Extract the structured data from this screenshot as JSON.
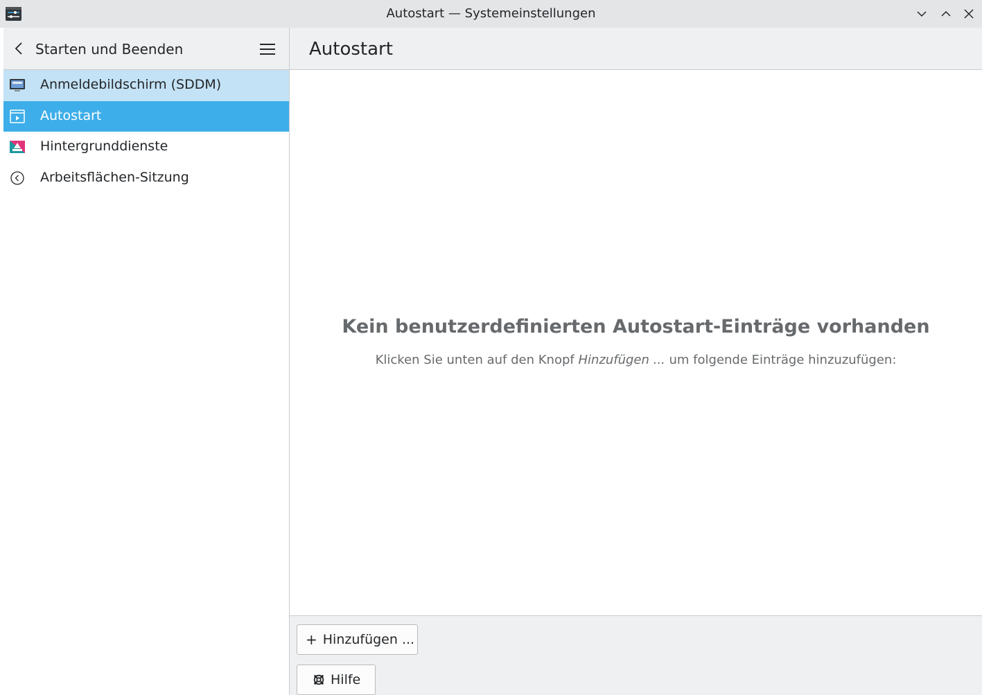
{
  "window": {
    "title": "Autostart — Systemeinstellungen",
    "icons": [
      "settings-app-icon",
      "minimize-icon",
      "maximize-icon",
      "close-icon"
    ]
  },
  "sidebar": {
    "title": "Starten und Beenden",
    "items": [
      {
        "label": "Anmeldebildschirm (SDDM)",
        "icon": "monitor-icon",
        "state": "hover"
      },
      {
        "label": "Autostart",
        "icon": "autostart-icon",
        "state": "selected"
      },
      {
        "label": "Hintergrunddienste",
        "icon": "services-icon",
        "state": "normal"
      },
      {
        "label": "Arbeitsflächen-Sitzung",
        "icon": "session-icon",
        "state": "normal"
      }
    ]
  },
  "main": {
    "title": "Autostart",
    "empty_title": "Kein benutzerdefinierten Autostart-Einträge vorhanden",
    "empty_sub_before": "Klicken Sie unten auf den Knopf ",
    "empty_sub_em": "Hinzufügen ...",
    "empty_sub_after": " um folgende Einträge hinzuzufügen:"
  },
  "footer": {
    "add_label": "Hinzufügen ...",
    "add_icon": "+",
    "help_label": "Hilfe"
  },
  "colors": {
    "accent": "#3daee9",
    "hover": "#c4e2f5",
    "header_bg": "#eff0f1"
  }
}
